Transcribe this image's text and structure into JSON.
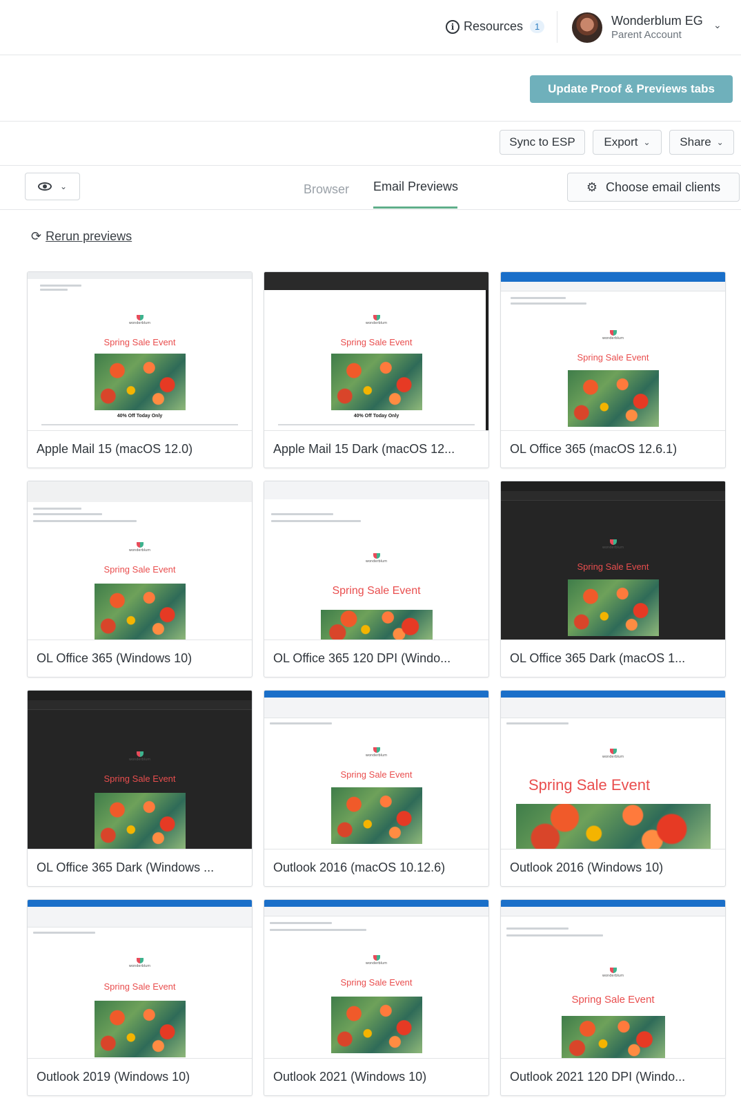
{
  "header": {
    "resources_label": "Resources",
    "resources_count": "1",
    "account_name": "Wonderblum EG",
    "account_role": "Parent Account"
  },
  "update_button": "Update Proof & Previews tabs",
  "actions": {
    "sync": "Sync to ESP",
    "export": "Export",
    "share": "Share"
  },
  "tabs": {
    "browser": "Browser",
    "email_previews": "Email Previews",
    "choose_clients": "Choose email clients"
  },
  "rerun_label": "Rerun previews",
  "email": {
    "headline": "Spring Sale Event",
    "offer": "40% Off Today Only",
    "brand": "wonderblum"
  },
  "cards": [
    {
      "label": "Apple Mail 15 (macOS 12.0)"
    },
    {
      "label": "Apple Mail 15 Dark (macOS 12..."
    },
    {
      "label": "OL Office 365 (macOS 12.6.1)"
    },
    {
      "label": "OL Office 365 (Windows 10)"
    },
    {
      "label": "OL Office 365 120 DPI (Windo..."
    },
    {
      "label": "OL Office 365 Dark (macOS 1..."
    },
    {
      "label": "OL Office 365 Dark (Windows ..."
    },
    {
      "label": "Outlook 2016 (macOS 10.12.6)"
    },
    {
      "label": "Outlook 2016 (Windows 10)"
    },
    {
      "label": "Outlook 2019 (Windows 10)"
    },
    {
      "label": "Outlook 2021 (Windows 10)"
    },
    {
      "label": "Outlook 2021 120 DPI (Windo..."
    }
  ],
  "colors": {
    "accent_button": "#6fb0bb",
    "tab_underline": "#5fae8a",
    "headline_red": "#e94e4e",
    "outlook_blue": "#1a6fc9"
  }
}
